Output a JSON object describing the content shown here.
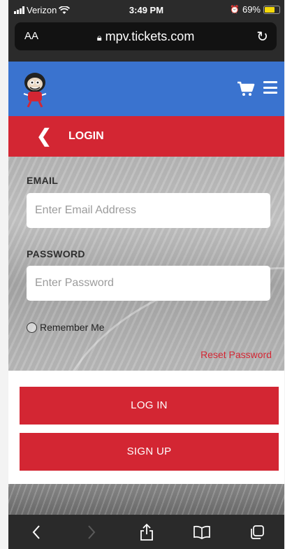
{
  "status_bar": {
    "carrier": "Verizon",
    "time": "3:49 PM",
    "battery_percent": "69%",
    "battery_level": 0.69
  },
  "browser": {
    "text_size_label": "AA",
    "url": "mpv.tickets.com"
  },
  "site_header": {
    "logo_icon": "team-mascot-logo",
    "cart_icon": "cart-icon",
    "menu_icon": "hamburger-menu-icon"
  },
  "login_bar": {
    "title": "LOGIN"
  },
  "form": {
    "email_label": "EMAIL",
    "email_placeholder": "Enter Email Address",
    "password_label": "PASSWORD",
    "password_placeholder": "Enter Password",
    "remember_label": "Remember Me",
    "reset_link": "Reset Password"
  },
  "actions": {
    "login_label": "LOG IN",
    "signup_label": "SIGN UP"
  },
  "colors": {
    "brand_blue": "#3a73cf",
    "brand_red": "#d32633"
  }
}
